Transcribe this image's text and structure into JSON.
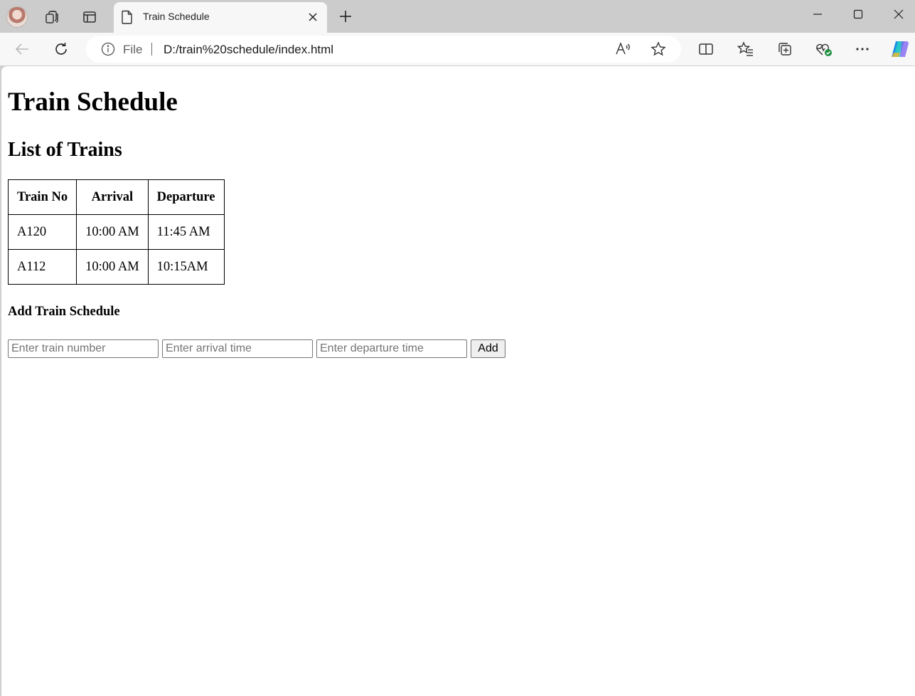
{
  "browser": {
    "tab_title": "Train Schedule",
    "address": {
      "scheme_label": "File",
      "url": "D:/train%20schedule/index.html"
    },
    "icons": [
      "profile-avatar",
      "workspaces-icon",
      "vertical-tabs-icon",
      "page-icon",
      "close-icon",
      "plus-icon",
      "minimize-icon",
      "maximize-icon",
      "window-close-icon",
      "back-icon",
      "refresh-icon",
      "info-icon",
      "read-aloud-icon",
      "favorite-star-icon",
      "split-screen-icon",
      "favorites-icon",
      "collections-icon",
      "browser-essentials-icon",
      "more-icon",
      "copilot-icon"
    ]
  },
  "page": {
    "heading": "Train Schedule",
    "list_heading": "List of Trains",
    "table": {
      "headers": [
        "Train No",
        "Arrival",
        "Departure"
      ],
      "rows": [
        [
          "A120",
          "10:00 AM",
          "11:45 AM"
        ],
        [
          "A112",
          "10:00 AM",
          "10:15AM"
        ]
      ]
    },
    "form": {
      "heading": "Add Train Schedule",
      "train_placeholder": "Enter train number",
      "arrival_placeholder": "Enter arrival time",
      "departure_placeholder": "Enter departure time",
      "add_label": "Add"
    }
  }
}
